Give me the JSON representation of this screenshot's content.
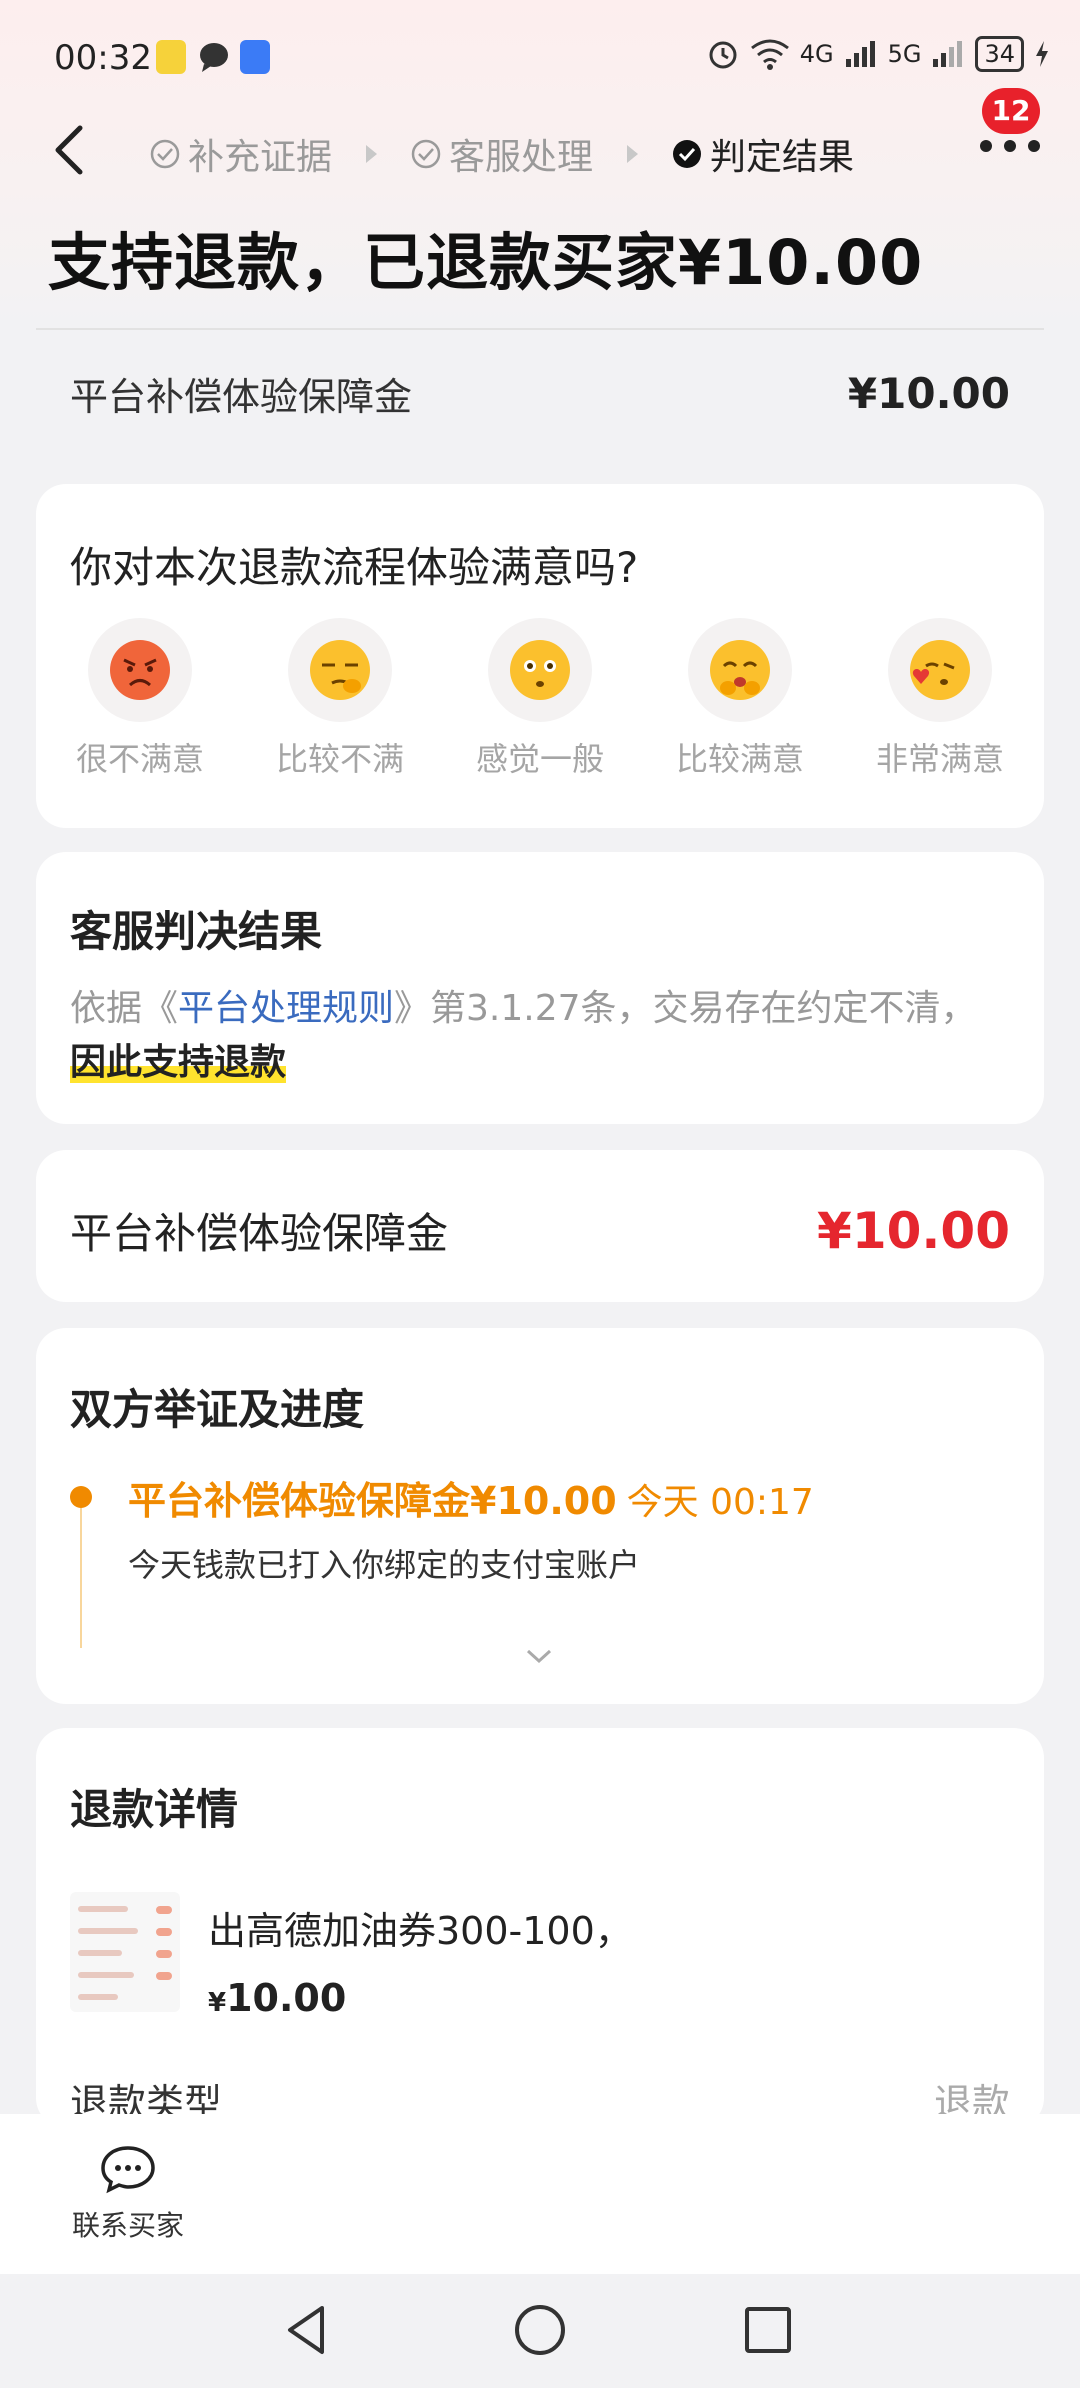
{
  "status_bar": {
    "time": "00:32",
    "network_4g": "4G",
    "network_5g": "5G",
    "battery": "34"
  },
  "nav": {
    "steps": [
      {
        "label": "补充证据"
      },
      {
        "label": "客服处理"
      },
      {
        "label": "判定结果"
      }
    ],
    "badge_count": "12"
  },
  "headline": "支持退款，已退款买家¥10.00",
  "summary": {
    "label": "平台补偿体验保障金",
    "value": "¥10.00"
  },
  "satisfaction": {
    "question": "你对本次退款流程体验满意吗?",
    "options": [
      {
        "label": "很不满意",
        "icon": "angry-face-icon"
      },
      {
        "label": "比较不满",
        "icon": "unamused-face-icon"
      },
      {
        "label": "感觉一般",
        "icon": "neutral-face-icon"
      },
      {
        "label": "比较满意",
        "icon": "smiling-face-icon"
      },
      {
        "label": "非常满意",
        "icon": "kissing-heart-face-icon"
      }
    ]
  },
  "verdict": {
    "title": "客服判决结果",
    "text_prefix": "依据《",
    "rule_link": "平台处理规则",
    "text_middle": "》第3.1.27条，交易存在约定不清，",
    "highlight": "因此支持退款"
  },
  "compensation": {
    "label": "平台补偿体验保障金",
    "value": "¥10.00"
  },
  "progress": {
    "title": "双方举证及进度",
    "item_title": "平台补偿体验保障金¥10.00",
    "item_time": "今天 00:17",
    "item_desc": "今天钱款已打入你绑定的支付宝账户"
  },
  "refund_detail": {
    "title": "退款详情",
    "product_name": "出高德加油券300-100，",
    "price_symbol": "¥",
    "price": "10.00",
    "type_label": "退款类型",
    "type_value": "退款"
  },
  "bottom": {
    "contact_label": "联系买家"
  },
  "colors": {
    "accent_red": "#e5262e",
    "accent_orange": "#f08a00",
    "badge_red": "#e8212b"
  }
}
